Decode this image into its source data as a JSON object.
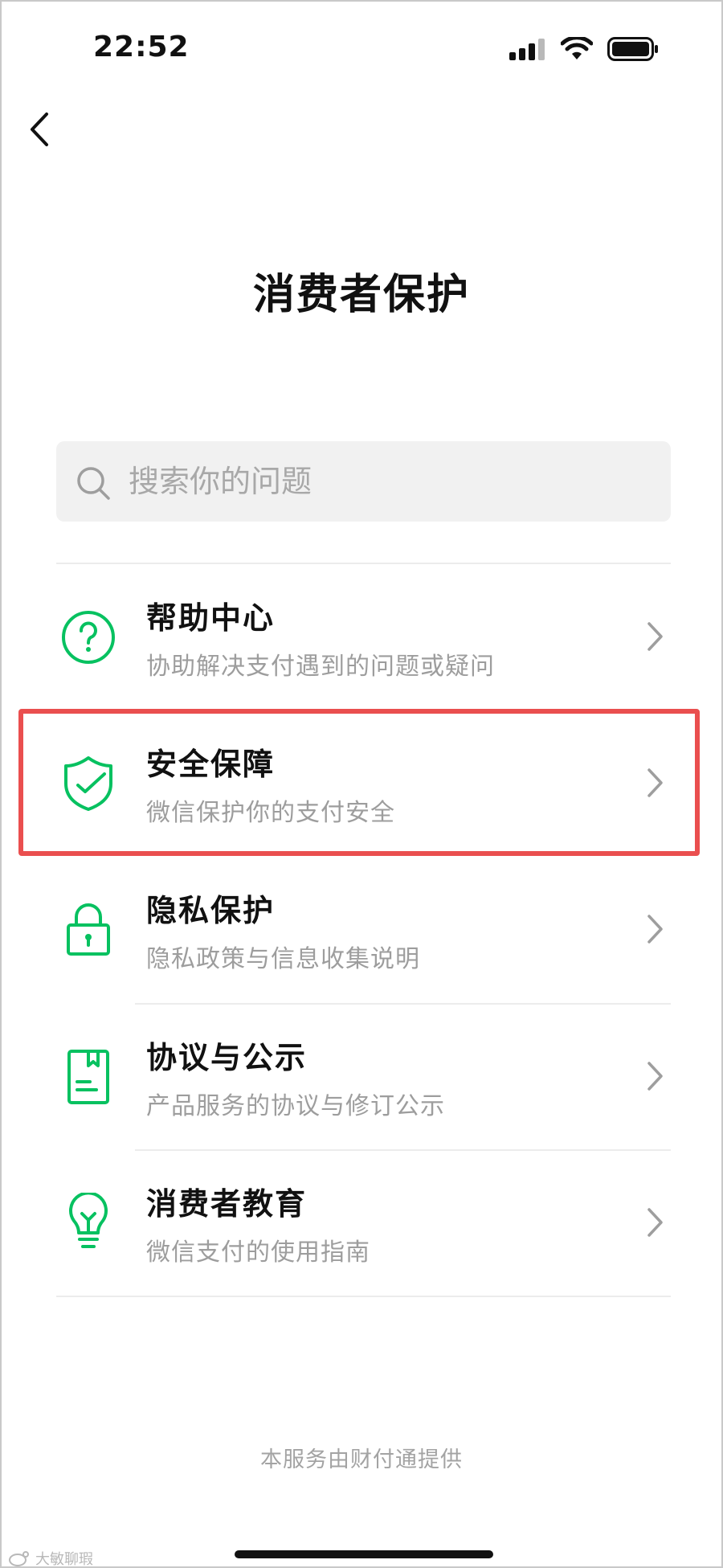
{
  "status_bar": {
    "time": "22:52"
  },
  "nav": {
    "title": "消费者保护"
  },
  "search": {
    "placeholder": "搜索你的问题"
  },
  "menu_items": [
    {
      "title": "帮助中心",
      "subtitle": "协助解决支付遇到的问题或疑问",
      "icon": "question-circle-icon"
    },
    {
      "title": "安全保障",
      "subtitle": "微信保护你的支付安全",
      "icon": "shield-check-icon"
    },
    {
      "title": "隐私保护",
      "subtitle": "隐私政策与信息收集说明",
      "icon": "lock-icon"
    },
    {
      "title": "协议与公示",
      "subtitle": "产品服务的协议与修订公示",
      "icon": "document-icon"
    },
    {
      "title": "消费者教育",
      "subtitle": "微信支付的使用指南",
      "icon": "lightbulb-icon"
    }
  ],
  "footer": {
    "text": "本服务由财付通提供"
  },
  "watermark": {
    "text": "大敏聊瑕"
  },
  "colors": {
    "accent": "#07c160",
    "highlight": "#ea4f4f"
  }
}
